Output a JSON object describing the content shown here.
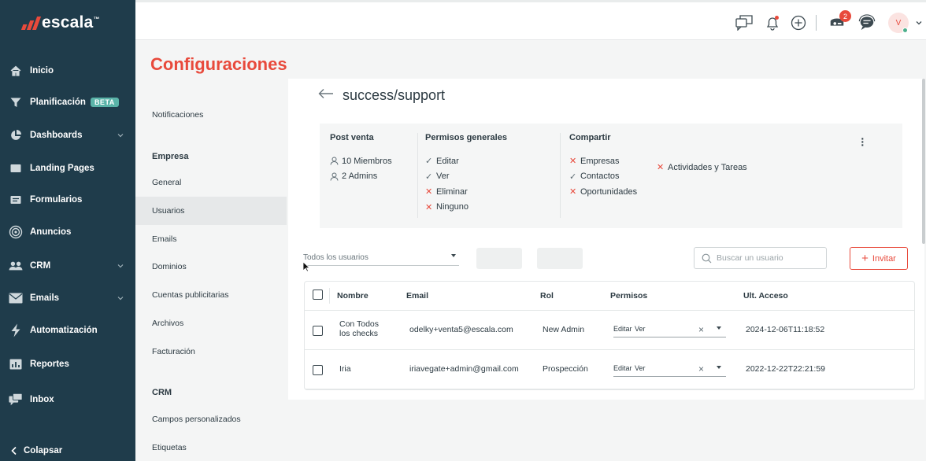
{
  "brand": {
    "name": "escala",
    "trademark": "™",
    "accent": "#e84a3c",
    "sidebar_bg": "#1f3c4b"
  },
  "sidebar": {
    "items": [
      {
        "label": "Inicio",
        "icon": "home-icon"
      },
      {
        "label": "Planificación",
        "icon": "funnel-icon",
        "badge": "BETA"
      },
      {
        "label": "Dashboards",
        "icon": "pie-chart-icon",
        "has_chevron": true
      },
      {
        "label": "Landing Pages",
        "icon": "folder-icon"
      },
      {
        "label": "Formularios",
        "icon": "form-icon"
      },
      {
        "label": "Anuncios",
        "icon": "target-icon"
      },
      {
        "label": "CRM",
        "icon": "users-icon",
        "has_chevron": true
      },
      {
        "label": "Emails",
        "icon": "mail-icon",
        "has_chevron": true
      },
      {
        "label": "Automatización",
        "icon": "lightning-icon"
      },
      {
        "label": "Reportes",
        "icon": "bar-chart-icon"
      },
      {
        "label": "Inbox",
        "icon": "chat-icon"
      }
    ],
    "collapse_label": "Colapsar"
  },
  "topbar": {
    "notification_count": "2",
    "avatar_initial": "V"
  },
  "page_title": "Configuraciones",
  "settings_nav": {
    "notifications": "Notificaciones",
    "empresa_heading": "Empresa",
    "empresa_items": [
      "General",
      "Usuarios",
      "Emails",
      "Dominios",
      "Cuentas publicitarias",
      "Archivos",
      "Facturación"
    ],
    "active": "Usuarios",
    "crm_heading": "CRM",
    "crm_items": [
      "Campos personalizados",
      "Etiquetas"
    ]
  },
  "group": {
    "title": "success/support",
    "summary": {
      "name": "Post venta",
      "members": "10 Miembros",
      "admins": "2 Admins",
      "permisos_heading": "Permisos generales",
      "permisos": [
        {
          "label": "Editar",
          "allowed": true
        },
        {
          "label": "Ver",
          "allowed": true
        },
        {
          "label": "Eliminar",
          "allowed": false
        },
        {
          "label": "Ninguno",
          "allowed": false
        }
      ],
      "compartir_heading": "Compartir",
      "compartir": [
        {
          "label": "Empresas",
          "allowed": false
        },
        {
          "label": "Contactos",
          "allowed": true
        },
        {
          "label": "Oportunidades",
          "allowed": false
        },
        {
          "label": "Actividades y Tareas",
          "allowed": false
        }
      ]
    }
  },
  "toolbar": {
    "filter_value": "Todos los usuarios",
    "search_placeholder": "Buscar un usuario",
    "invite_label": "Invitar"
  },
  "table": {
    "columns": [
      "Nombre",
      "Email",
      "Rol",
      "Permisos",
      "Ult. Acceso"
    ],
    "rows": [
      {
        "name": "Con Todos los checks",
        "email": "odelky+venta5@escala.com",
        "role": "New Admin",
        "perms": [
          "Editar",
          "Ver"
        ],
        "last_access": "2024-12-06T11:18:52"
      },
      {
        "name": "Iria",
        "email": "iriavegate+admin@gmail.com",
        "role": "Prospección",
        "perms": [
          "Editar",
          "Ver"
        ],
        "last_access": "2022-12-22T22:21:59"
      }
    ]
  }
}
